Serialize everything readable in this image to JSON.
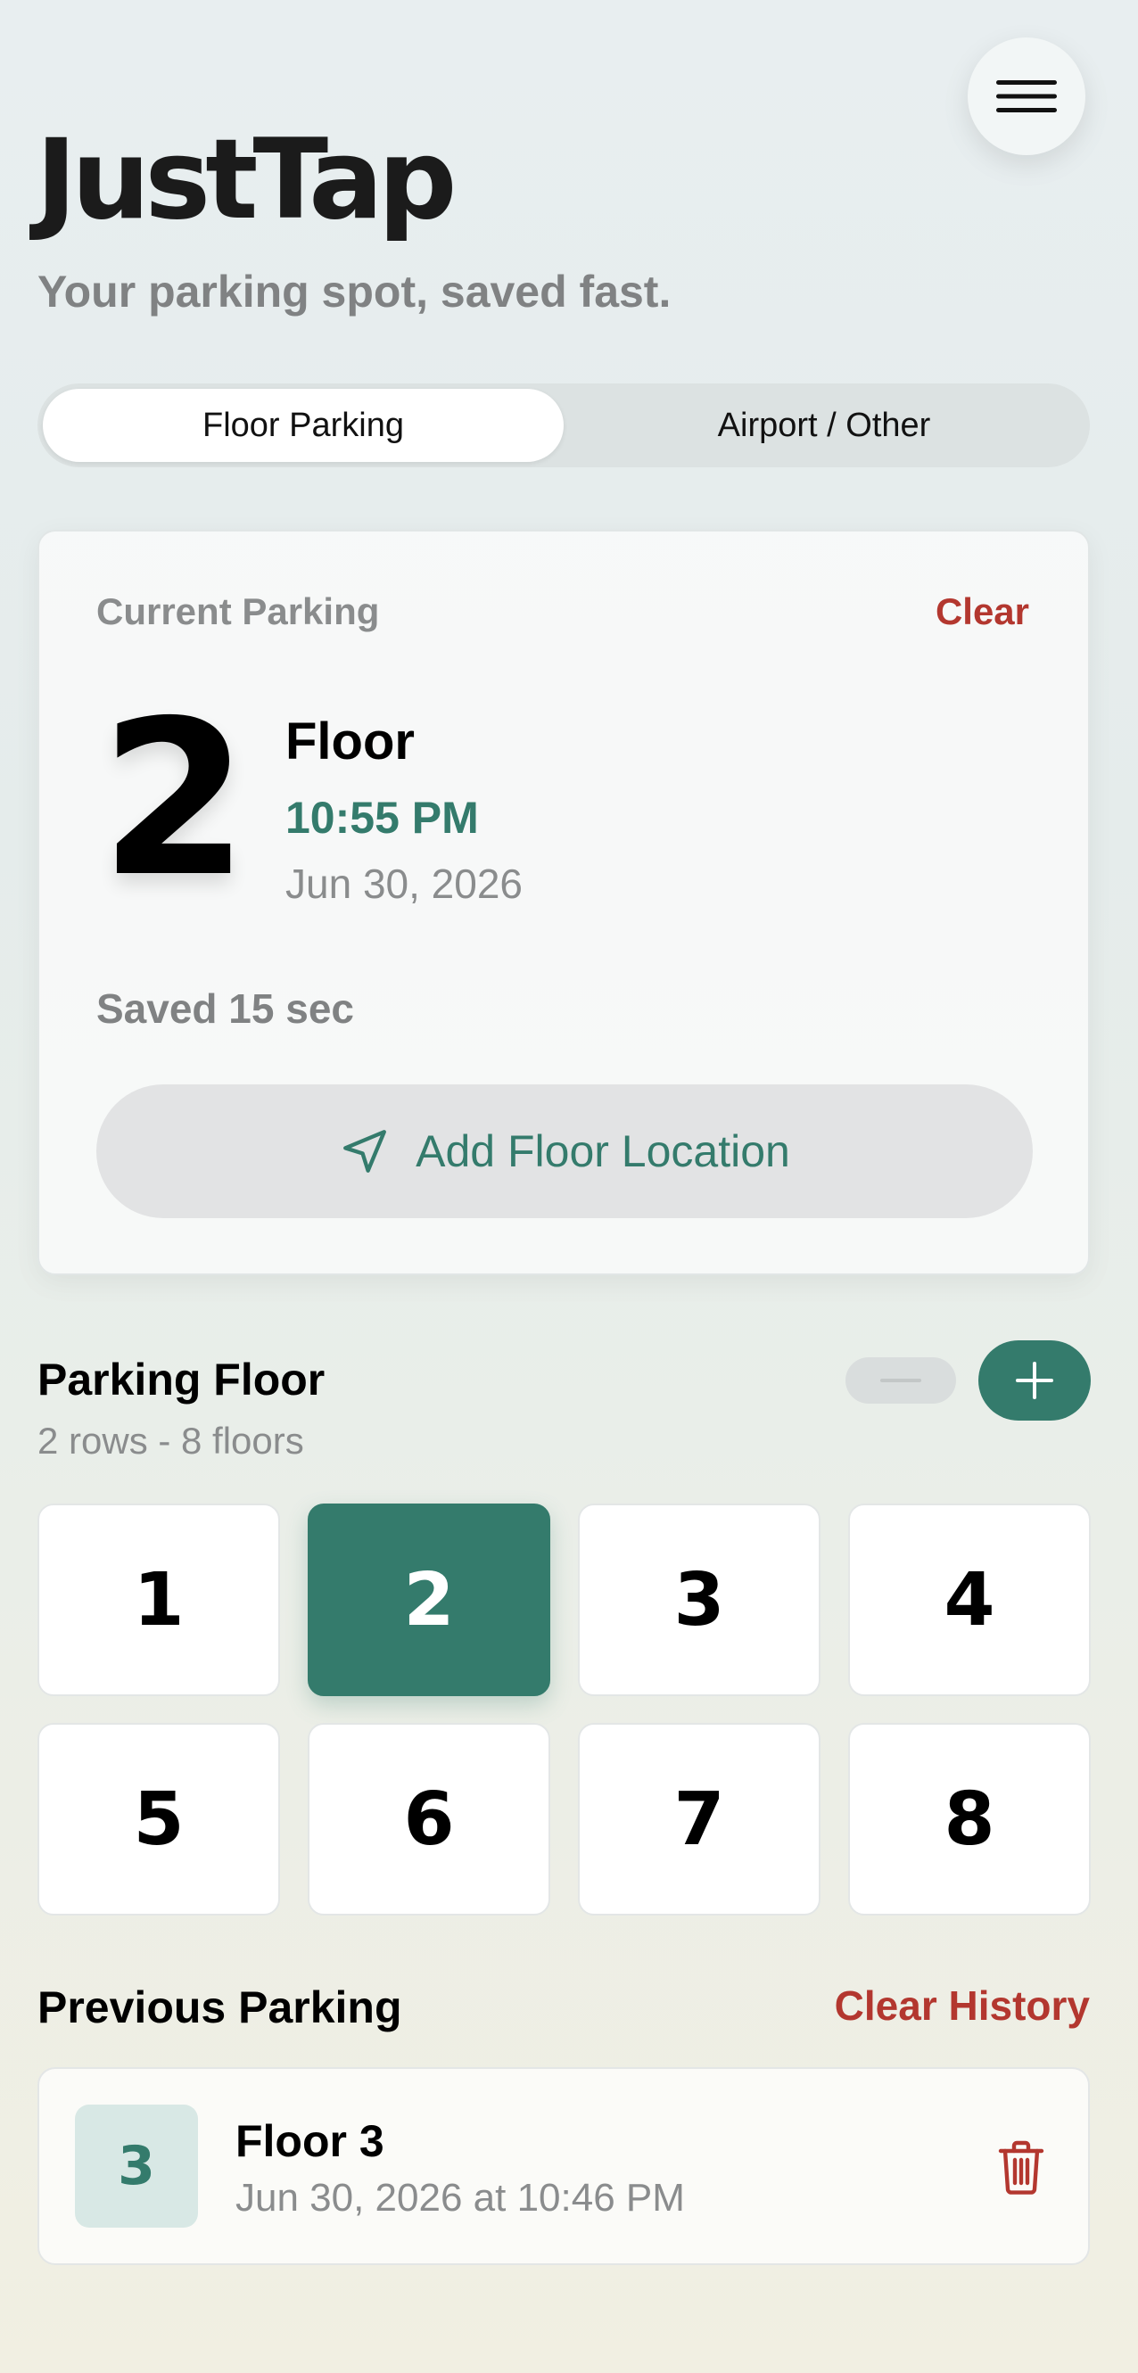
{
  "app": {
    "title": "JustTap",
    "subtitle": "Your parking spot, saved fast."
  },
  "tabs": [
    {
      "label": "Floor Parking",
      "active": true
    },
    {
      "label": "Airport / Other",
      "active": false
    }
  ],
  "current_parking": {
    "label": "Current Parking",
    "clear_label": "Clear",
    "floor_number": "2",
    "floor_word": "Floor",
    "time": "10:55 PM",
    "date": "Jun 30, 2026",
    "saved_ago": "Saved 15 sec",
    "add_location_label": "Add Floor Location"
  },
  "parking_floor": {
    "title": "Parking Floor",
    "subtitle": "2 rows - 8 floors",
    "floors": [
      "1",
      "2",
      "3",
      "4",
      "5",
      "6",
      "7",
      "8"
    ],
    "selected": "2"
  },
  "previous_parking": {
    "title": "Previous Parking",
    "clear_history_label": "Clear History",
    "items": [
      {
        "badge": "3",
        "title": "Floor 3",
        "date": "Jun 30, 2026 at 10:46 PM"
      }
    ]
  },
  "colors": {
    "accent": "#347b6c",
    "danger": "#b3372f",
    "muted": "#8a8c8d"
  },
  "icons": {
    "menu": "hamburger-icon",
    "location": "navigation-arrow-icon",
    "minus": "minus-icon",
    "plus": "plus-icon",
    "trash": "trash-icon"
  }
}
